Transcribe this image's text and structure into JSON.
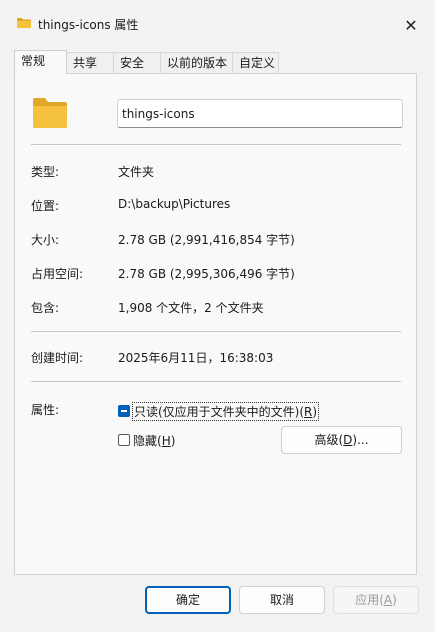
{
  "window": {
    "title": "things-icons 属性",
    "close": "✕"
  },
  "tabs": [
    {
      "label": "常规"
    },
    {
      "label": "共享"
    },
    {
      "label": "安全"
    },
    {
      "label": "以前的版本"
    },
    {
      "label": "自定义"
    }
  ],
  "general": {
    "folder_name": "things-icons",
    "type_label": "类型:",
    "type_value": "文件夹",
    "location_label": "位置:",
    "location_value": "D:\\backup\\Pictures",
    "size_label": "大小:",
    "size_value": "2.78 GB (2,991,416,854 字节)",
    "disk_label": "占用空间:",
    "disk_value": "2.78 GB (2,995,306,496 字节)",
    "contains_label": "包含:",
    "contains_value": "1,908 个文件，2 个文件夹",
    "created_label": "创建时间:",
    "created_value": "2025年6月11日，16:38:03",
    "attrs_label": "属性:",
    "readonly": {
      "label": "只读(仅应用于文件夹中的文件)(",
      "key": "R",
      "tail": ")",
      "state": "indeterminate"
    },
    "hidden": {
      "label": "隐藏(",
      "key": "H",
      "tail": ")",
      "state": "unchecked"
    },
    "advanced": {
      "label": "高级(",
      "key": "D",
      "tail": ")..."
    }
  },
  "footer": {
    "ok": "确定",
    "cancel": "取消",
    "apply": {
      "label": "应用(",
      "key": "A",
      "tail": ")"
    }
  },
  "colors": {
    "accent": "#005fb8",
    "folder": "#f6c23e",
    "folder_back": "#e0a72a"
  }
}
